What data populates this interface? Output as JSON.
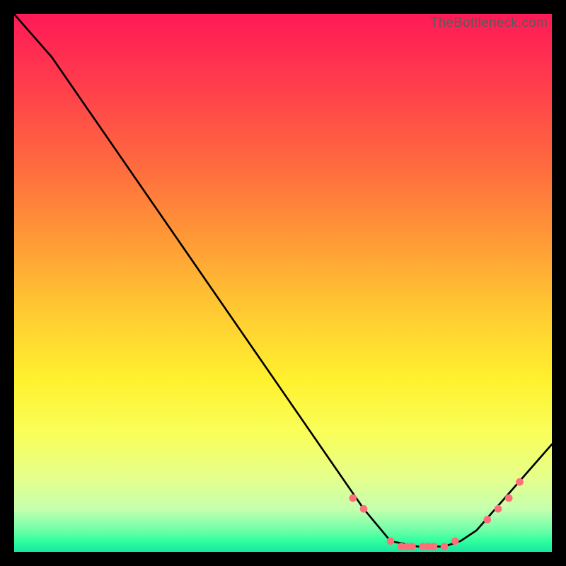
{
  "watermark": "TheBottleneck.com",
  "chart_data": {
    "type": "line",
    "title": "",
    "xlabel": "",
    "ylabel": "",
    "xlim": [
      0,
      100
    ],
    "ylim": [
      0,
      100
    ],
    "series": [
      {
        "name": "bottleneck-curve",
        "x": [
          0,
          7,
          65,
          70,
          75,
          80,
          83,
          86,
          100
        ],
        "values": [
          100,
          92,
          8,
          2,
          1,
          1,
          2,
          4,
          20
        ]
      }
    ],
    "markers": {
      "name": "highlight-points",
      "color": "#ff6f7a",
      "x": [
        63,
        65,
        70,
        72,
        73,
        74,
        76,
        77,
        78,
        80,
        82,
        88,
        90,
        92,
        94
      ],
      "values": [
        10,
        8,
        2,
        1,
        1,
        1,
        1,
        1,
        1,
        1,
        2,
        6,
        8,
        10,
        13
      ]
    }
  }
}
